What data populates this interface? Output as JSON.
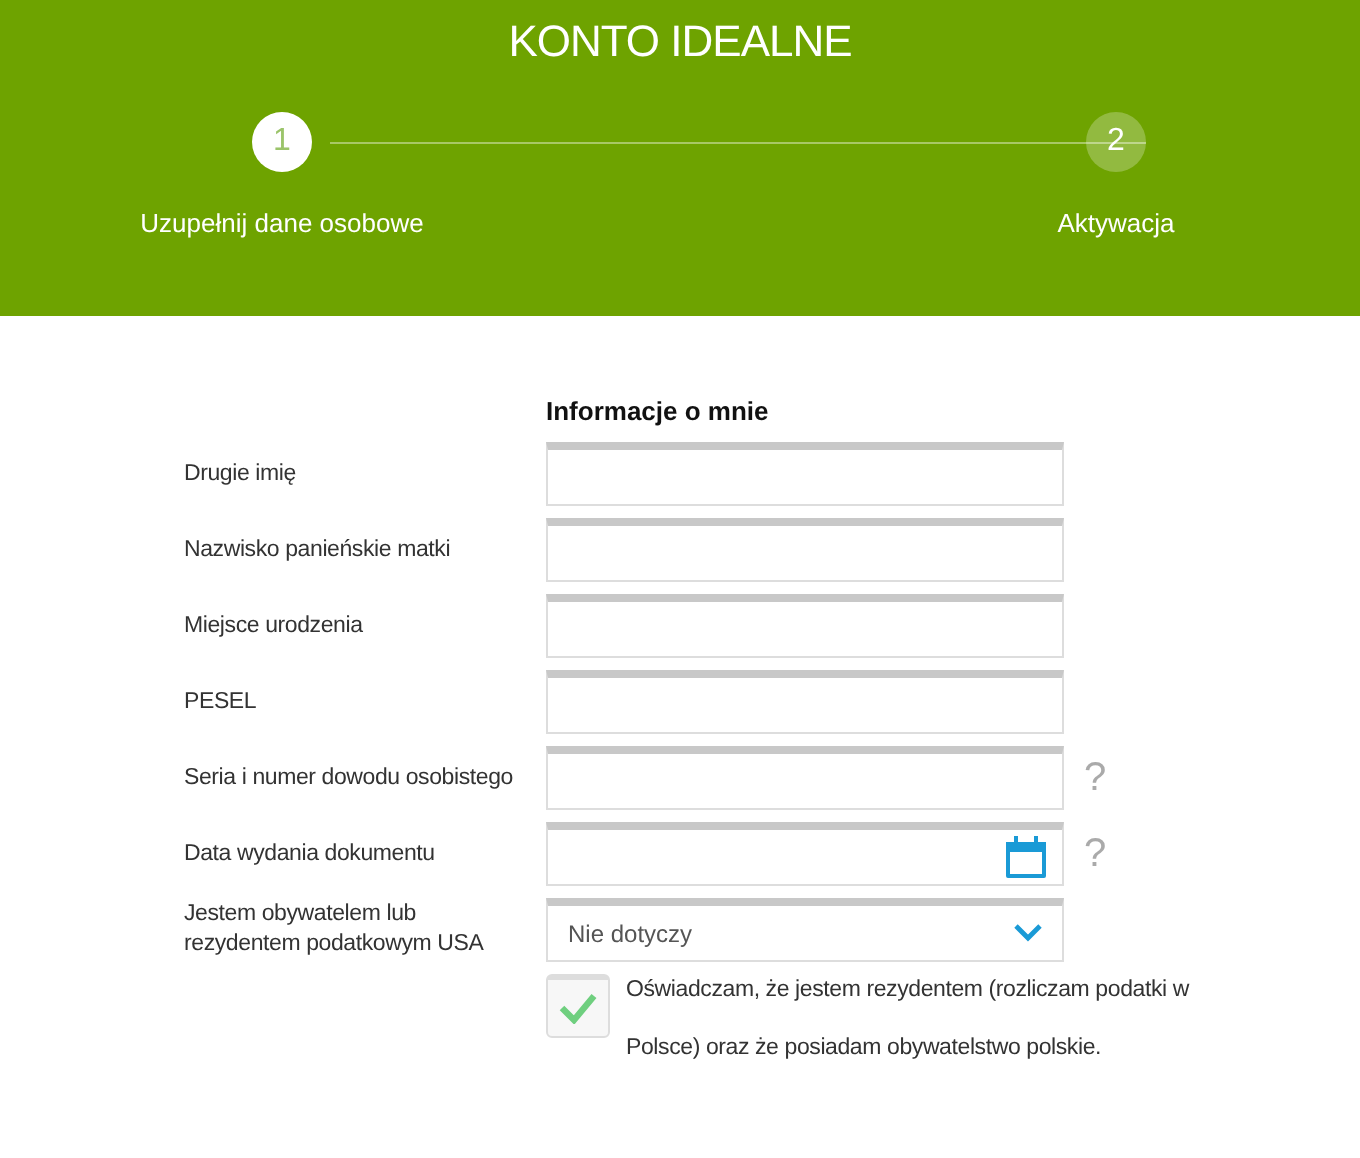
{
  "header": {
    "title": "KONTO IDEALNE"
  },
  "steps": [
    {
      "number": "1",
      "label": "Uzupełnij dane osobowe",
      "selected": true
    },
    {
      "number": "2",
      "label": "Aktywacja",
      "selected": false
    }
  ],
  "form": {
    "heading": "Informacje o mnie",
    "fields": [
      {
        "kind": "text",
        "label": "Drugie imię"
      },
      {
        "kind": "text",
        "label": "Nazwisko panieńskie matki"
      },
      {
        "kind": "text",
        "label": "Miejsce urodzenia"
      },
      {
        "kind": "text",
        "label": "PESEL"
      },
      {
        "kind": "text",
        "label": "Seria i numer dowodu osobistego",
        "help_text": "?"
      },
      {
        "kind": "date",
        "label": "Data wydania dokumentu",
        "help_text": "?"
      },
      {
        "kind": "select",
        "label": "Jestem obywatelem lub rezydentem podatkowym USA",
        "value": "Nie dotyczy"
      }
    ],
    "consent": {
      "checked": true,
      "text": "Oświadczam, że jestem rezydentem (rozliczam podatki w Polsce) oraz że posiadam obywatelstwo polskie."
    }
  }
}
